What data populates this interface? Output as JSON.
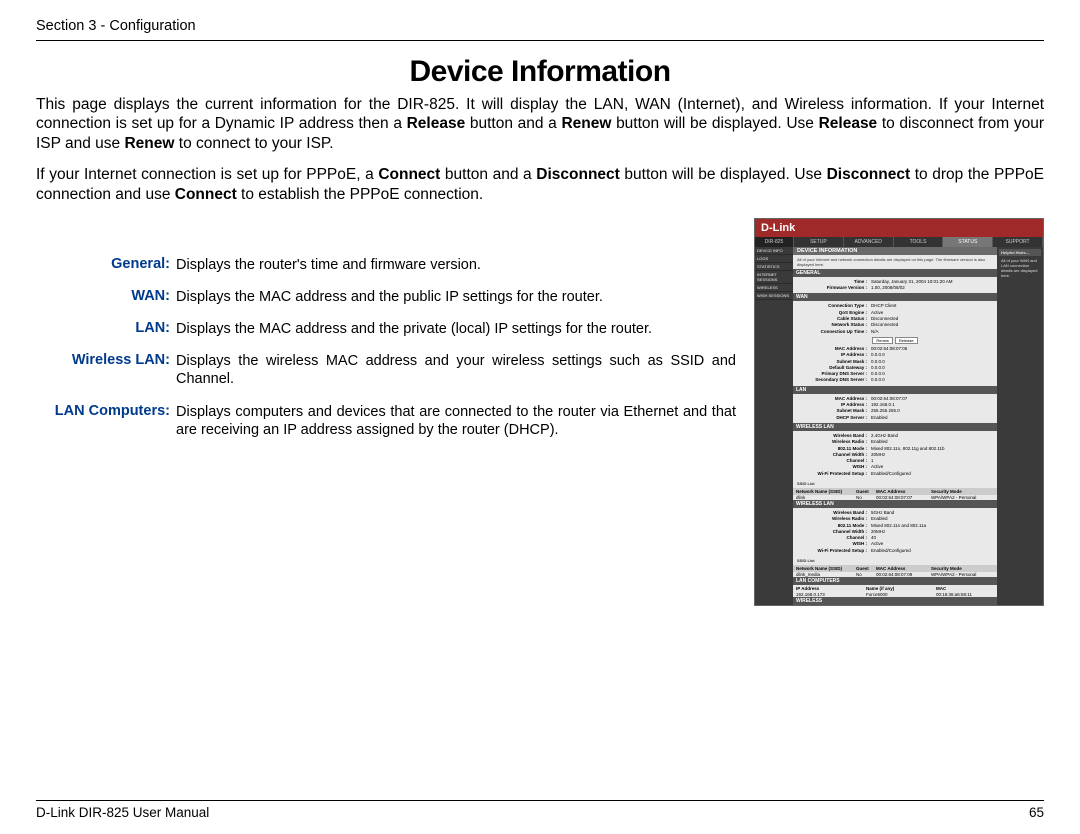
{
  "header": {
    "section": "Section 3 - Configuration"
  },
  "title": "Device Information",
  "intro1_parts": [
    "This page displays the current information for the DIR-825. It will display the LAN, WAN (Internet), and Wireless information. If your Internet connection is set up for a Dynamic IP address then a ",
    "Release",
    " button and a ",
    "Renew",
    " button will be displayed. Use ",
    "Release",
    " to disconnect from your ISP and use ",
    "Renew",
    " to connect to your ISP."
  ],
  "intro2_parts": [
    "If your Internet connection is set up for PPPoE, a ",
    "Connect",
    " button and a ",
    "Disconnect",
    " button will be displayed. Use ",
    "Disconnect",
    " to drop the PPPoE connection and use ",
    "Connect",
    " to establish the PPPoE connection."
  ],
  "defs": [
    {
      "term": "General:",
      "desc": "Displays the router's time and firmware version."
    },
    {
      "term": "WAN:",
      "desc": "Displays the MAC address and the public IP settings for the router."
    },
    {
      "term": "LAN:",
      "desc": "Displays the MAC address and the private (local) IP settings for the router."
    },
    {
      "term": "Wireless LAN:",
      "desc": "Displays the wireless MAC address and your wireless settings such as SSID and Channel."
    },
    {
      "term": "LAN Computers:",
      "desc": "Displays computers and devices that are connected to the router via Ethernet and that are receiving an IP address assigned by the router (DHCP)."
    }
  ],
  "screenshot": {
    "brand": "D-Link",
    "model": "DIR-825",
    "tabs": [
      "SETUP",
      "ADVANCED",
      "TOOLS",
      "STATUS",
      "SUPPORT"
    ],
    "side": [
      "DEVICE INFO",
      "LOGS",
      "STATISTICS",
      "INTERNET SESSIONS",
      "WIRELESS",
      "WISH SESSIONS"
    ],
    "hint_title": "Helpful Hints…",
    "hint_text": "All of your WAN and LAN connection details are displayed here.",
    "pagetitle": "DEVICE INFORMATION",
    "pagedesc": "All of your Internet and network connection details are displayed on this page. The firmware version is also displayed here.",
    "general": {
      "label": "GENERAL",
      "rows": [
        {
          "k": "Time :",
          "v": "Saturday, January 31, 2004 10:01:20 AM"
        },
        {
          "k": "Firmware Version :",
          "v": "1.00,  2008/08/02"
        }
      ]
    },
    "wan": {
      "label": "WAN",
      "rows1": [
        {
          "k": "Connection Type :",
          "v": "DHCP Client"
        },
        {
          "k": "QoS Engine :",
          "v": "Active"
        },
        {
          "k": "Cable Status :",
          "v": "Disconnected"
        },
        {
          "k": "Network Status :",
          "v": "Disconnected"
        },
        {
          "k": "Connection Up Time :",
          "v": "N/A"
        }
      ],
      "btns": [
        "Renew",
        "Release"
      ],
      "rows2": [
        {
          "k": "MAC Address :",
          "v": "00:02:64:08:07:06"
        },
        {
          "k": "IP Address :",
          "v": "0.0.0.0"
        },
        {
          "k": "Subnet Mask :",
          "v": "0.0.0.0"
        },
        {
          "k": "Default Gateway :",
          "v": "0.0.0.0"
        },
        {
          "k": "Primary DNS Server :",
          "v": "0.0.0.0"
        },
        {
          "k": "Secondary DNS Server :",
          "v": "0.0.0.0"
        }
      ]
    },
    "lan": {
      "label": "LAN",
      "rows": [
        {
          "k": "MAC Address :",
          "v": "00:02:64:08:07:07"
        },
        {
          "k": "IP Address :",
          "v": "192.168.0.1"
        },
        {
          "k": "Subnet Mask :",
          "v": "255.255.255.0"
        },
        {
          "k": "DHCP Server :",
          "v": "Enabled"
        }
      ]
    },
    "wlan1": {
      "label": "WIRELESS LAN",
      "rows": [
        {
          "k": "Wireless Band :",
          "v": "2.4GHz Band"
        },
        {
          "k": "Wireless Radio :",
          "v": "Enabled"
        },
        {
          "k": "802.11 Mode :",
          "v": "Mixed 802.11n, 802.11g and 802.11b"
        },
        {
          "k": "Channel Width :",
          "v": "20MHz"
        },
        {
          "k": "Channel :",
          "v": "1"
        },
        {
          "k": "WISH :",
          "v": "Active"
        },
        {
          "k": "Wi-Fi Protected Setup :",
          "v": "Enabled/Configured"
        }
      ],
      "ssid_label": "SSID List",
      "cols": [
        "Network Name (SSID)",
        "Guest",
        "MAC Address",
        "Security Mode"
      ],
      "row": [
        "dlink",
        "No",
        "00:02:64:08:07:07",
        "WPA/WPA2 - Personal"
      ]
    },
    "wlan2": {
      "label": "WIRELESS LAN",
      "rows": [
        {
          "k": "Wireless Band :",
          "v": "5GHz Band"
        },
        {
          "k": "Wireless Radio :",
          "v": "Enabled"
        },
        {
          "k": "802.11 Mode :",
          "v": "Mixed 802.11n and 802.11a"
        },
        {
          "k": "Channel Width :",
          "v": "20MHz"
        },
        {
          "k": "Channel :",
          "v": "40"
        },
        {
          "k": "WISH :",
          "v": "Active"
        },
        {
          "k": "Wi-Fi Protected Setup :",
          "v": "Enabled/Configured"
        }
      ],
      "ssid_label": "SSID List",
      "cols": [
        "Network Name (SSID)",
        "Guest",
        "MAC Address",
        "Security Mode"
      ],
      "row": [
        "dlink_media",
        "No",
        "00:02:64:08:07:09",
        "WPA/WPA2 - Personal"
      ]
    },
    "lancomp": {
      "label": "LAN COMPUTERS",
      "cols": [
        "IP Address",
        "Name (if any)",
        "MAC"
      ],
      "row": [
        "192.168.0.173",
        "Force5000",
        "00:16:36:a6:58:11"
      ]
    },
    "wireless_hdr": "WIRELESS"
  },
  "footer": {
    "left": "D-Link DIR-825 User Manual",
    "right": "65"
  }
}
